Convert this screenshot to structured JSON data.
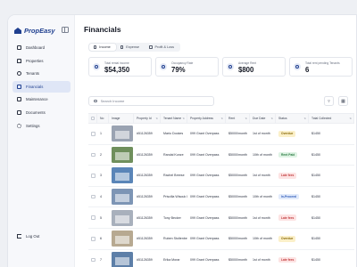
{
  "app": {
    "name": "PropEasy"
  },
  "sidebar": {
    "items": [
      {
        "label": "Dashboard",
        "icon": "dashboard-icon",
        "active": false
      },
      {
        "label": "Properties",
        "icon": "house-icon",
        "active": false
      },
      {
        "label": "Tenants",
        "icon": "people-icon",
        "active": false
      },
      {
        "label": "Financials",
        "icon": "folder-icon",
        "active": true
      },
      {
        "label": "Maintenance",
        "icon": "wrench-icon",
        "active": false
      },
      {
        "label": "Documents",
        "icon": "document-icon",
        "active": false
      },
      {
        "label": "Settings",
        "icon": "gear-icon",
        "active": false
      }
    ],
    "logout_label": "Log Out"
  },
  "page": {
    "title": "Financials"
  },
  "tabs": [
    {
      "label": "Income",
      "active": true
    },
    {
      "label": "Expense",
      "active": false
    },
    {
      "label": "Profit & Loss",
      "active": false
    }
  ],
  "stats": [
    {
      "label": "Total rental income",
      "value": "$54,350"
    },
    {
      "label": "Occupancy Rate",
      "value": "79%"
    },
    {
      "label": "Average Rent",
      "value": "$800"
    },
    {
      "label": "Total rent pending Tenants",
      "value": "6"
    }
  ],
  "search": {
    "placeholder": "Search Income",
    "value": ""
  },
  "table": {
    "columns": [
      "No",
      "Image",
      "Property Id",
      "Tenant Name",
      "Property Address",
      "Rent",
      "Due Date",
      "Status",
      "Total Collected"
    ],
    "rows": [
      {
        "no": "1",
        "property_id": "#51126359",
        "tenant": "Mario Dookes",
        "address": "099 Grant Overpass",
        "rent": "$5000/month",
        "due": "1st of month",
        "status": "Overdue",
        "total": "$1450",
        "thumb": "#9aa3b2"
      },
      {
        "no": "2",
        "property_id": "#51126359",
        "tenant": "Randal Kunze",
        "address": "099 Grant Overpass",
        "rent": "$5000/month",
        "due": "10th of month",
        "status": "Rent Paid",
        "total": "$1450",
        "thumb": "#6f8f5c"
      },
      {
        "no": "3",
        "property_id": "#51126359",
        "tenant": "Rachel Breese",
        "address": "099 Grant Overpass",
        "rent": "$5000/month",
        "due": "1st of month",
        "status": "Late fees",
        "total": "$1450",
        "thumb": "#5a85b8"
      },
      {
        "no": "4",
        "property_id": "#51126359",
        "tenant": "Priscilla Wisouk I",
        "address": "099 Grant Overpass",
        "rent": "$5000/month",
        "due": "10th of month",
        "status": "In-Proceed",
        "total": "$1450",
        "thumb": "#7d95b5"
      },
      {
        "no": "5",
        "property_id": "#51126359",
        "tenant": "Tony Becker",
        "address": "099 Grant Overpass",
        "rent": "$5000/month",
        "due": "1st of month",
        "status": "Late fees",
        "total": "$1450",
        "thumb": "#a8b0bc"
      },
      {
        "no": "6",
        "property_id": "#51126359",
        "tenant": "Ruben Stoltenberg",
        "address": "099 Grant Overpass",
        "rent": "$5000/month",
        "due": "10th of month",
        "status": "Overdue",
        "total": "$1450",
        "thumb": "#b7a991"
      },
      {
        "no": "7",
        "property_id": "#51126359",
        "tenant": "Erika Morar",
        "address": "099 Grant Overpass",
        "rent": "$5000/month",
        "due": "1st of month",
        "status": "Late fees",
        "total": "$1450",
        "thumb": "#5d7fa8"
      }
    ]
  },
  "status_styles": {
    "Overdue": {
      "bg": "#fbf0c9",
      "fg": "#8a6a0b"
    },
    "Rent Paid": {
      "bg": "#dff3e4",
      "fg": "#2e7d46"
    },
    "Late fees": {
      "bg": "#fde3e3",
      "fg": "#c0393b"
    },
    "In-Proceed": {
      "bg": "#e2ebfb",
      "fg": "#2f5bb8"
    }
  },
  "colors": {
    "brand": "#1f3f8f",
    "active_nav_bg": "#dfe6f6"
  }
}
